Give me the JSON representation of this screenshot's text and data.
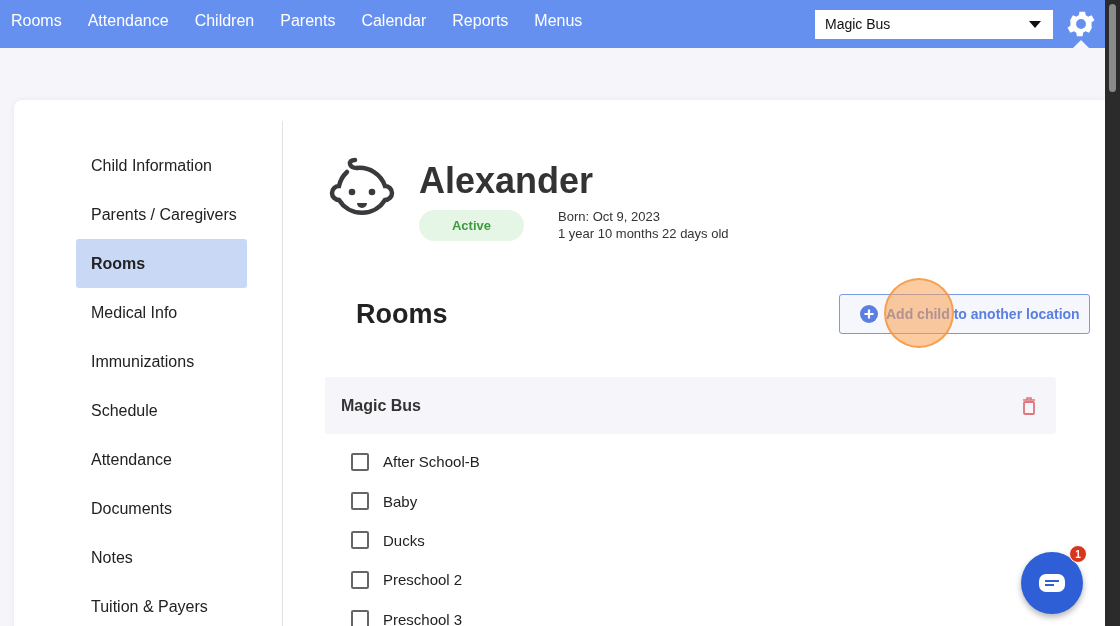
{
  "nav": {
    "links": [
      {
        "label": "Rooms",
        "selected": false
      },
      {
        "label": "Attendance",
        "selected": false
      },
      {
        "label": "Children",
        "selected": false
      },
      {
        "label": "Parents",
        "selected": false
      },
      {
        "label": "Calendar",
        "selected": false
      },
      {
        "label": "Reports",
        "selected": false
      },
      {
        "label": "Menus",
        "selected": false
      }
    ],
    "location_select": {
      "value": "Magic Bus"
    }
  },
  "sidebar": {
    "items": [
      {
        "label": "Child Information",
        "selected": false
      },
      {
        "label": "Parents / Caregivers",
        "selected": false
      },
      {
        "label": "Rooms",
        "selected": true
      },
      {
        "label": "Medical Info",
        "selected": false
      },
      {
        "label": "Immunizations",
        "selected": false
      },
      {
        "label": "Schedule",
        "selected": false
      },
      {
        "label": "Attendance",
        "selected": false
      },
      {
        "label": "Documents",
        "selected": false
      },
      {
        "label": "Notes",
        "selected": false
      },
      {
        "label": "Tuition & Payers",
        "selected": false
      }
    ]
  },
  "child": {
    "name": "Alexander",
    "status": "Active",
    "born": "Born: Oct 9, 2023",
    "age": "1 year 10 months 22 days old"
  },
  "section": {
    "title": "Rooms",
    "add_button": "Add child to another location"
  },
  "location": {
    "name": "Magic Bus",
    "rooms": [
      {
        "label": "After School-B",
        "checked": false
      },
      {
        "label": "Baby",
        "checked": false
      },
      {
        "label": "Ducks",
        "checked": false
      },
      {
        "label": "Preschool 2",
        "checked": false
      },
      {
        "label": "Preschool 3",
        "checked": false
      }
    ]
  },
  "chat": {
    "badge": "1"
  }
}
